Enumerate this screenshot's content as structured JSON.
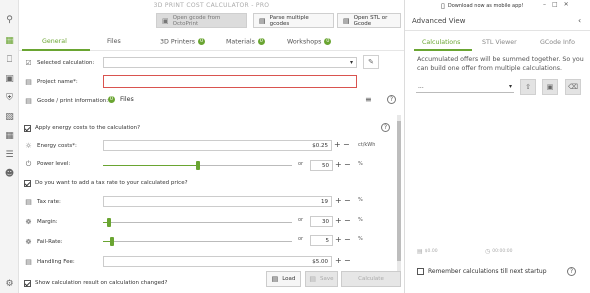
{
  "title": "3D PRINT COST CALCULATOR - PRO",
  "top_buttons": {
    "octoprint": "Open gcode from OctoPrint",
    "multiple": "Parse multiple gcodes",
    "stl": "Open STL or Gcode"
  },
  "tabs": [
    {
      "label": "General"
    },
    {
      "label": "Files"
    },
    {
      "label": "3D Printers",
      "badge": "0"
    },
    {
      "label": "Materials",
      "badge": "0"
    },
    {
      "label": "Workshops",
      "badge": "0"
    }
  ],
  "form": {
    "selected_calculation_label": "Selected calculation:",
    "project_name_label": "Project name*:",
    "project_name_value": "",
    "gcode_info_label": "Gcode / print information:",
    "files_badge": "0",
    "files_text": "Files",
    "apply_energy_label": "Apply energy costs to the calculation?",
    "energy_costs_label": "Energy costs*:",
    "energy_costs_value": "$0.25",
    "energy_unit": "ct/kWh",
    "power_level_label": "Power level:",
    "power_level_value": "50",
    "percent_unit": "%",
    "or_text": "or",
    "tax_question_label": "Do you want to add a tax rate to your calculated price?",
    "tax_rate_label": "Tax rate:",
    "tax_rate_value": "19",
    "margin_label": "Margin:",
    "margin_value": "30",
    "fail_rate_label": "Fail-Rate:",
    "fail_rate_value": "5",
    "handling_fee_label": "Handling Fee:",
    "handling_fee_value": "$5.00",
    "show_result_label": "Show calculation result on calculation changed?"
  },
  "sliders": {
    "power_level": 0.5,
    "margin": 0.03,
    "fail_rate": 0.05
  },
  "bottom_buttons": {
    "load": "Load",
    "save": "Save",
    "calculate": "Calculate"
  },
  "right_panel": {
    "title": "Advanced View",
    "download_text": "Download now as mobile app!",
    "tabs": [
      "Calculations",
      "STL Viewer",
      "GCode Info"
    ],
    "info_text": "Accumulated offers will be summed together. So you can build one offer from multiple calculations.",
    "select_value": "...",
    "total_left": "$0.00",
    "total_right": "00:00:00",
    "remember_label": "Remember calculations till next startup"
  },
  "colors": {
    "accent": "#6aa532",
    "error_border": "#d9534f"
  }
}
